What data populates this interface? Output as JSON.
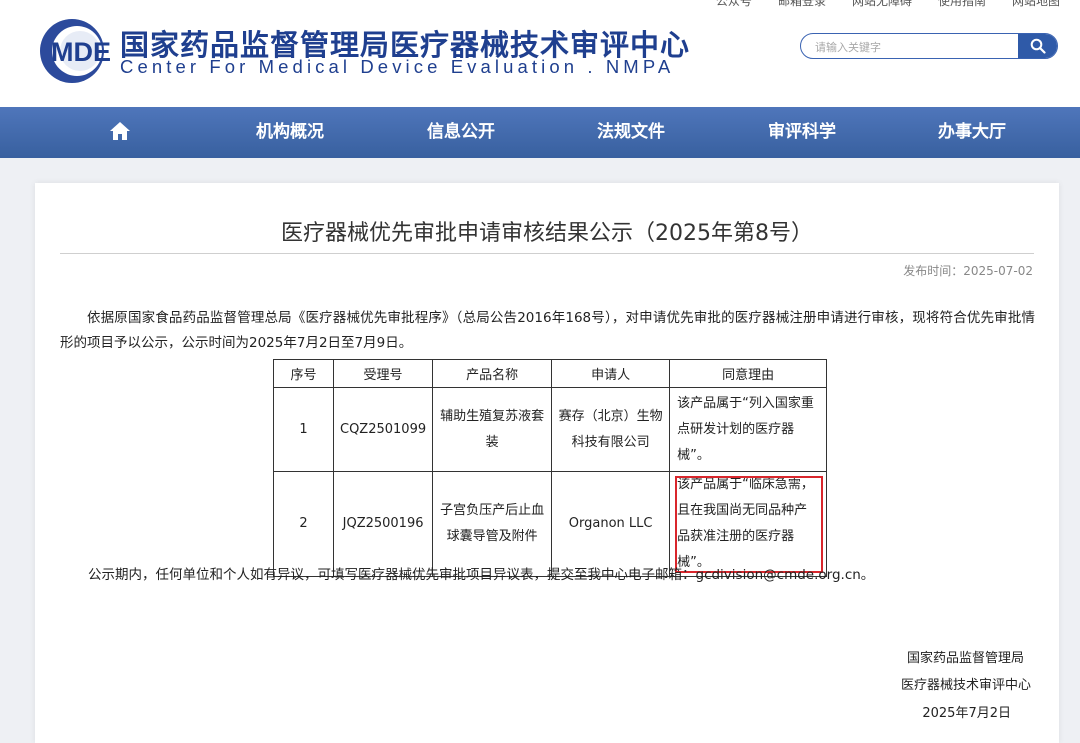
{
  "header": {
    "top_links": [
      "公众号",
      "邮箱登录",
      "网站无障碍",
      "使用指南",
      "网站地图"
    ],
    "logo_mark": "MDE",
    "logo_cn": "国家药品监督管理局医疗器械技术审评中心",
    "logo_en": "Center For Medical Device Evaluation . NMPA",
    "search_placeholder": "请输入关键字",
    "search_icon": "search-icon"
  },
  "nav": {
    "home_icon": "home-icon",
    "items": [
      "机构概况",
      "信息公开",
      "法规文件",
      "审评科学",
      "办事大厅"
    ]
  },
  "article": {
    "title": "医疗器械优先审批申请审核结果公示（2025年第8号）",
    "publish_time": "发布时间：2025-07-02",
    "intro": "依据原国家食品药品监督管理总局《医疗器械优先审批程序》（总局公告2016年168号），对申请优先审批的医疗器械注册申请进行审核，现将符合优先审批情形的项目予以公示，公示时间为2025年7月2日至7月9日。",
    "table": {
      "headers": [
        "序号",
        "受理号",
        "产品名称",
        "申请人",
        "同意理由"
      ],
      "rows": [
        [
          "1",
          "CQZ2501099",
          "辅助生殖复苏液套装",
          "赛存（北京）生物科技有限公司",
          "该产品属于“列入国家重点研发计划的医疗器械”。"
        ],
        [
          "2",
          "JQZ2500196",
          "子宫负压产后止血球囊导管及附件",
          "Organon LLC",
          "该产品属于“临床急需，且在我国尚无同品种产品获准注册的医疗器械”。"
        ]
      ]
    },
    "objection_note": "公示期内，任何单位和个人如有异议，可填写医疗器械优先审批项目异议表，提交至我中心电子邮箱：gcdivision@cmde.org.cn。",
    "signature": [
      "国家药品监督管理局",
      "医疗器械技术审评中心",
      "2025年7月2日"
    ]
  },
  "colors": {
    "brand": "#1f3f8f",
    "nav_bg": "#4569ad",
    "highlight": "#d9262c"
  }
}
